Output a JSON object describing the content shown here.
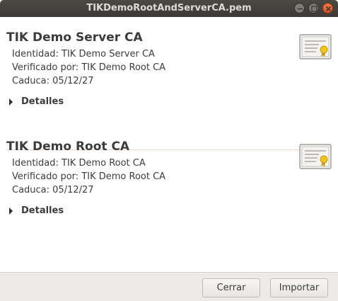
{
  "window": {
    "title": "TIKDemoRootAndServerCA.pem"
  },
  "certificates": [
    {
      "name": "TIK Demo Server CA",
      "identity": "Identidad: TIK Demo Server CA",
      "verified_by": "Verificado por: TIK Demo Root CA",
      "expires": "Caduca: 05/12/27",
      "details_label": "Detalles"
    },
    {
      "name": "TIK Demo Root CA",
      "identity": "Identidad: TIK Demo Root CA",
      "verified_by": "Verificado por: TIK Demo Root CA",
      "expires": "Caduca: 05/12/27",
      "details_label": "Detalles"
    }
  ],
  "buttons": {
    "close_label": "Cerrar",
    "import_label": "Importar"
  },
  "icons": [
    "minimize-icon",
    "maximize-icon",
    "close-icon",
    "certificate-icon",
    "expander-triangle-icon"
  ],
  "colors": {
    "titlebar": "#3c3b37",
    "close_button": "#e9612f",
    "separator": "#f0d9c8"
  }
}
